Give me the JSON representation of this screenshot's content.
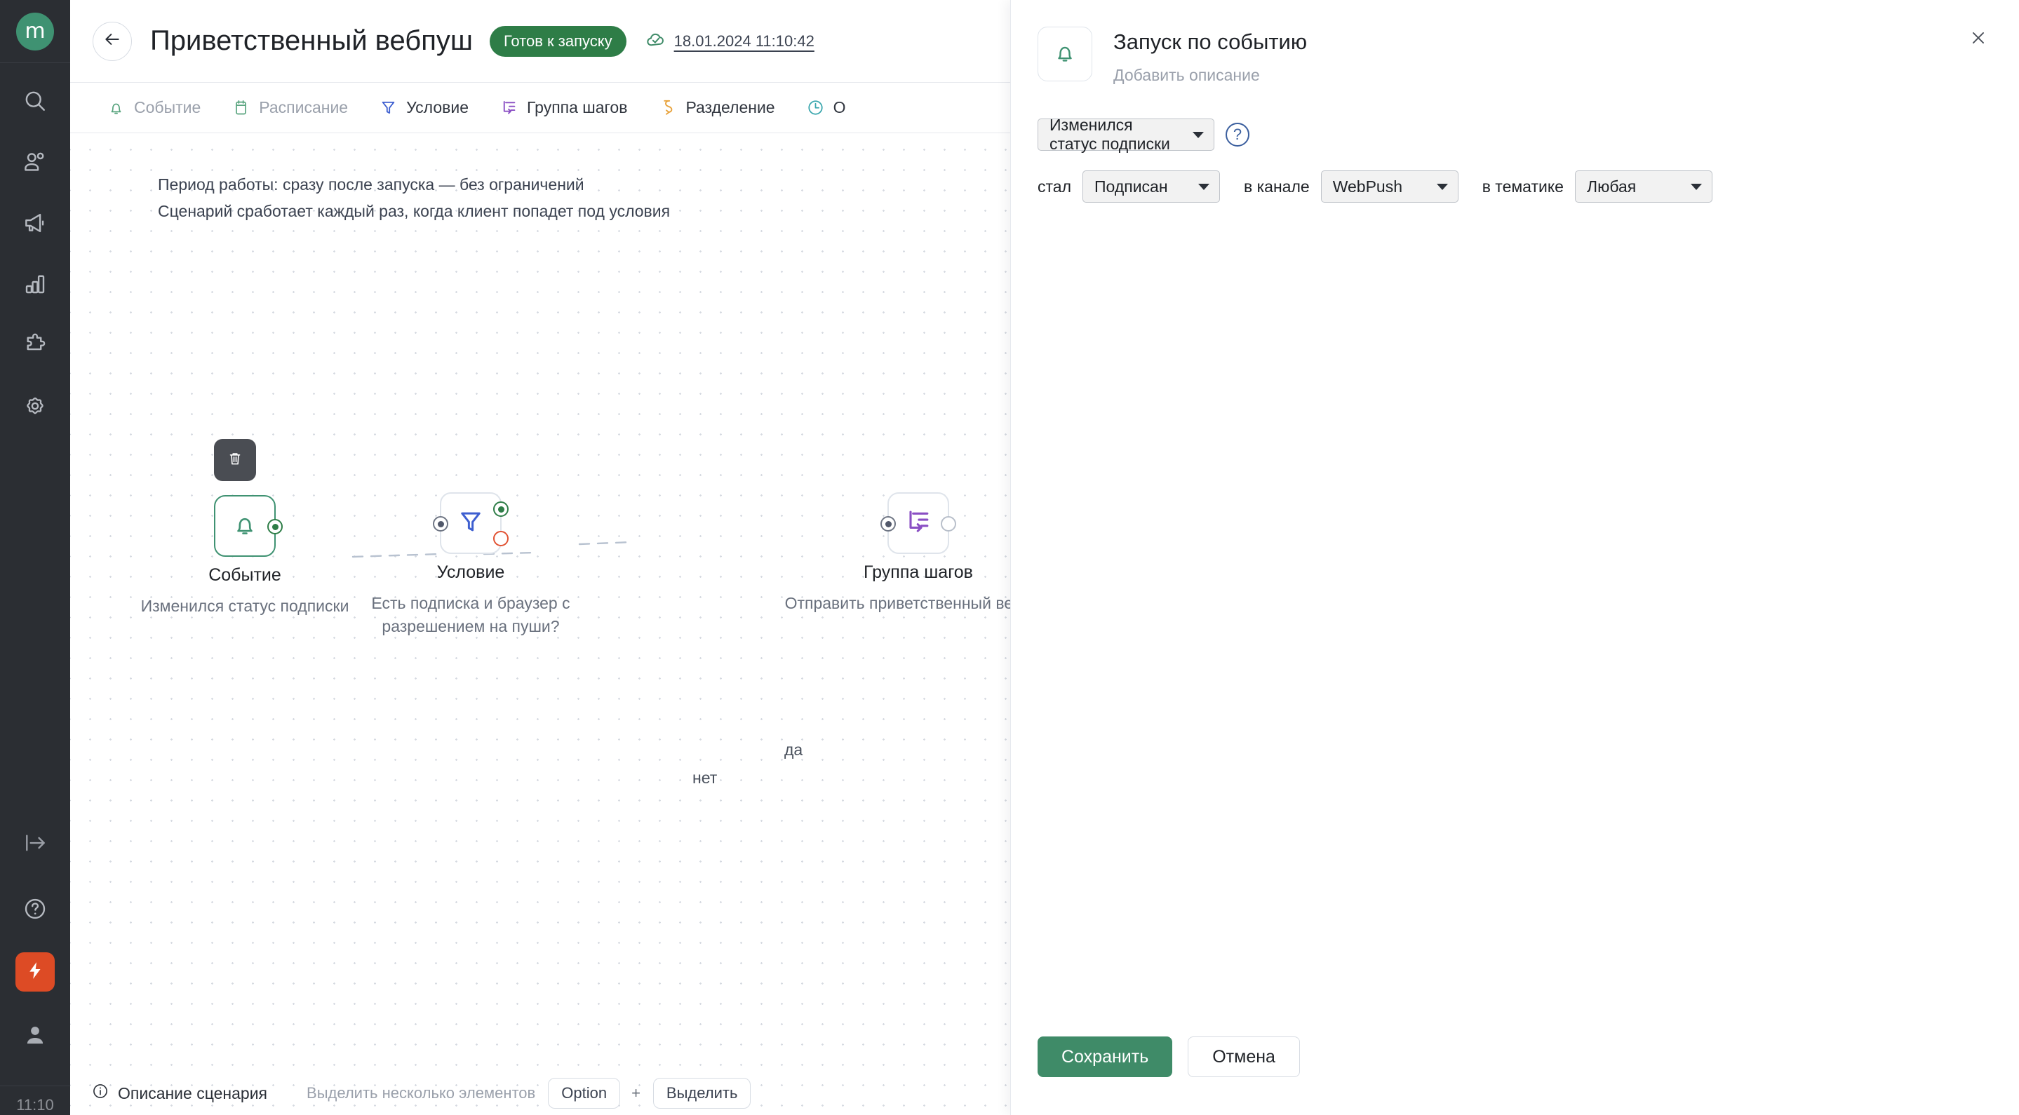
{
  "colors": {
    "brand_green": "#3f9272",
    "badge_green": "#2e7d47",
    "accent_orange": "#dd4b25",
    "rail_bg": "#2b2e33",
    "save_green": "#3f8b68"
  },
  "rail": {
    "logo_text": "m",
    "items": [
      {
        "name": "search-icon",
        "label": "Поиск"
      },
      {
        "name": "contacts-icon",
        "label": "Контакты"
      },
      {
        "name": "campaigns-icon",
        "label": "Кампании"
      },
      {
        "name": "analytics-icon",
        "label": "Аналитика"
      },
      {
        "name": "integrations-icon",
        "label": "Интеграции"
      },
      {
        "name": "settings-icon",
        "label": "Настройки"
      }
    ],
    "bottom_items": [
      {
        "name": "collapse-icon",
        "label": "Свернуть"
      },
      {
        "name": "help-icon",
        "label": "Помощь"
      },
      {
        "name": "bolt-icon",
        "label": "Быстрые действия"
      },
      {
        "name": "user-icon",
        "label": "Профиль"
      }
    ],
    "clock": "11:10"
  },
  "topbar": {
    "back_label": "Назад",
    "title": "Приветственный вебпуш",
    "status_badge": "Готов к запуску",
    "saved_time": "18.01.2024 11:10:42"
  },
  "toolbar": {
    "items": [
      {
        "label": "Событие",
        "icon": "bell-icon",
        "color": "#57a37d",
        "muted": true
      },
      {
        "label": "Расписание",
        "icon": "calendar-icon",
        "color": "#57a37d",
        "muted": true
      },
      {
        "label": "Условие",
        "icon": "filter-icon",
        "color": "#3e5fd0",
        "muted": false
      },
      {
        "label": "Группа шагов",
        "icon": "steps-group-icon",
        "color": "#8a4fc4",
        "muted": false
      },
      {
        "label": "Разделение",
        "icon": "split-icon",
        "color": "#e8a33d",
        "muted": false
      },
      {
        "label": "О",
        "icon": "clock-icon",
        "color": "#3ba7ae",
        "muted": false
      }
    ]
  },
  "canvas": {
    "period_line1": "Период работы: сразу после запуска — без ограничений",
    "period_line2": "Сценарий сработает каждый раз, когда клиент попадет под условия",
    "nodes": [
      {
        "title": "Событие",
        "subtitle": "Изменился статус подписки",
        "icon": "bell-icon",
        "selected": true,
        "has_trash": true,
        "trash_label": "Удалить"
      },
      {
        "title": "Условие",
        "subtitle": "Есть подписка и браузер с разрешением на пуши?",
        "icon": "filter-icon",
        "selected": false,
        "has_trash": false
      },
      {
        "title": "Группа шагов",
        "subtitle": "Отправить приветственный вебпуш",
        "icon": "steps-group-icon",
        "selected": false,
        "has_trash": false
      }
    ],
    "edge_labels": {
      "yes": "да",
      "no": "нет"
    }
  },
  "statusbar": {
    "description_label": "Описание сценария",
    "hint": "Выделить несколько элементов",
    "key_option": "Option",
    "plus": "+",
    "key_select": "Выделить"
  },
  "panel": {
    "icon": "bell-icon",
    "title": "Запуск по событию",
    "description_placeholder": "Добавить описание",
    "close_label": "Закрыть",
    "trigger_select": "Изменился статус подписки",
    "help_glyph": "?",
    "label_became": "стал",
    "status_select": "Подписан",
    "label_channel": "в канале",
    "channel_select": "WebPush",
    "label_topic": "в тематике",
    "topic_select": "Любая",
    "save_label": "Сохранить",
    "cancel_label": "Отмена"
  }
}
